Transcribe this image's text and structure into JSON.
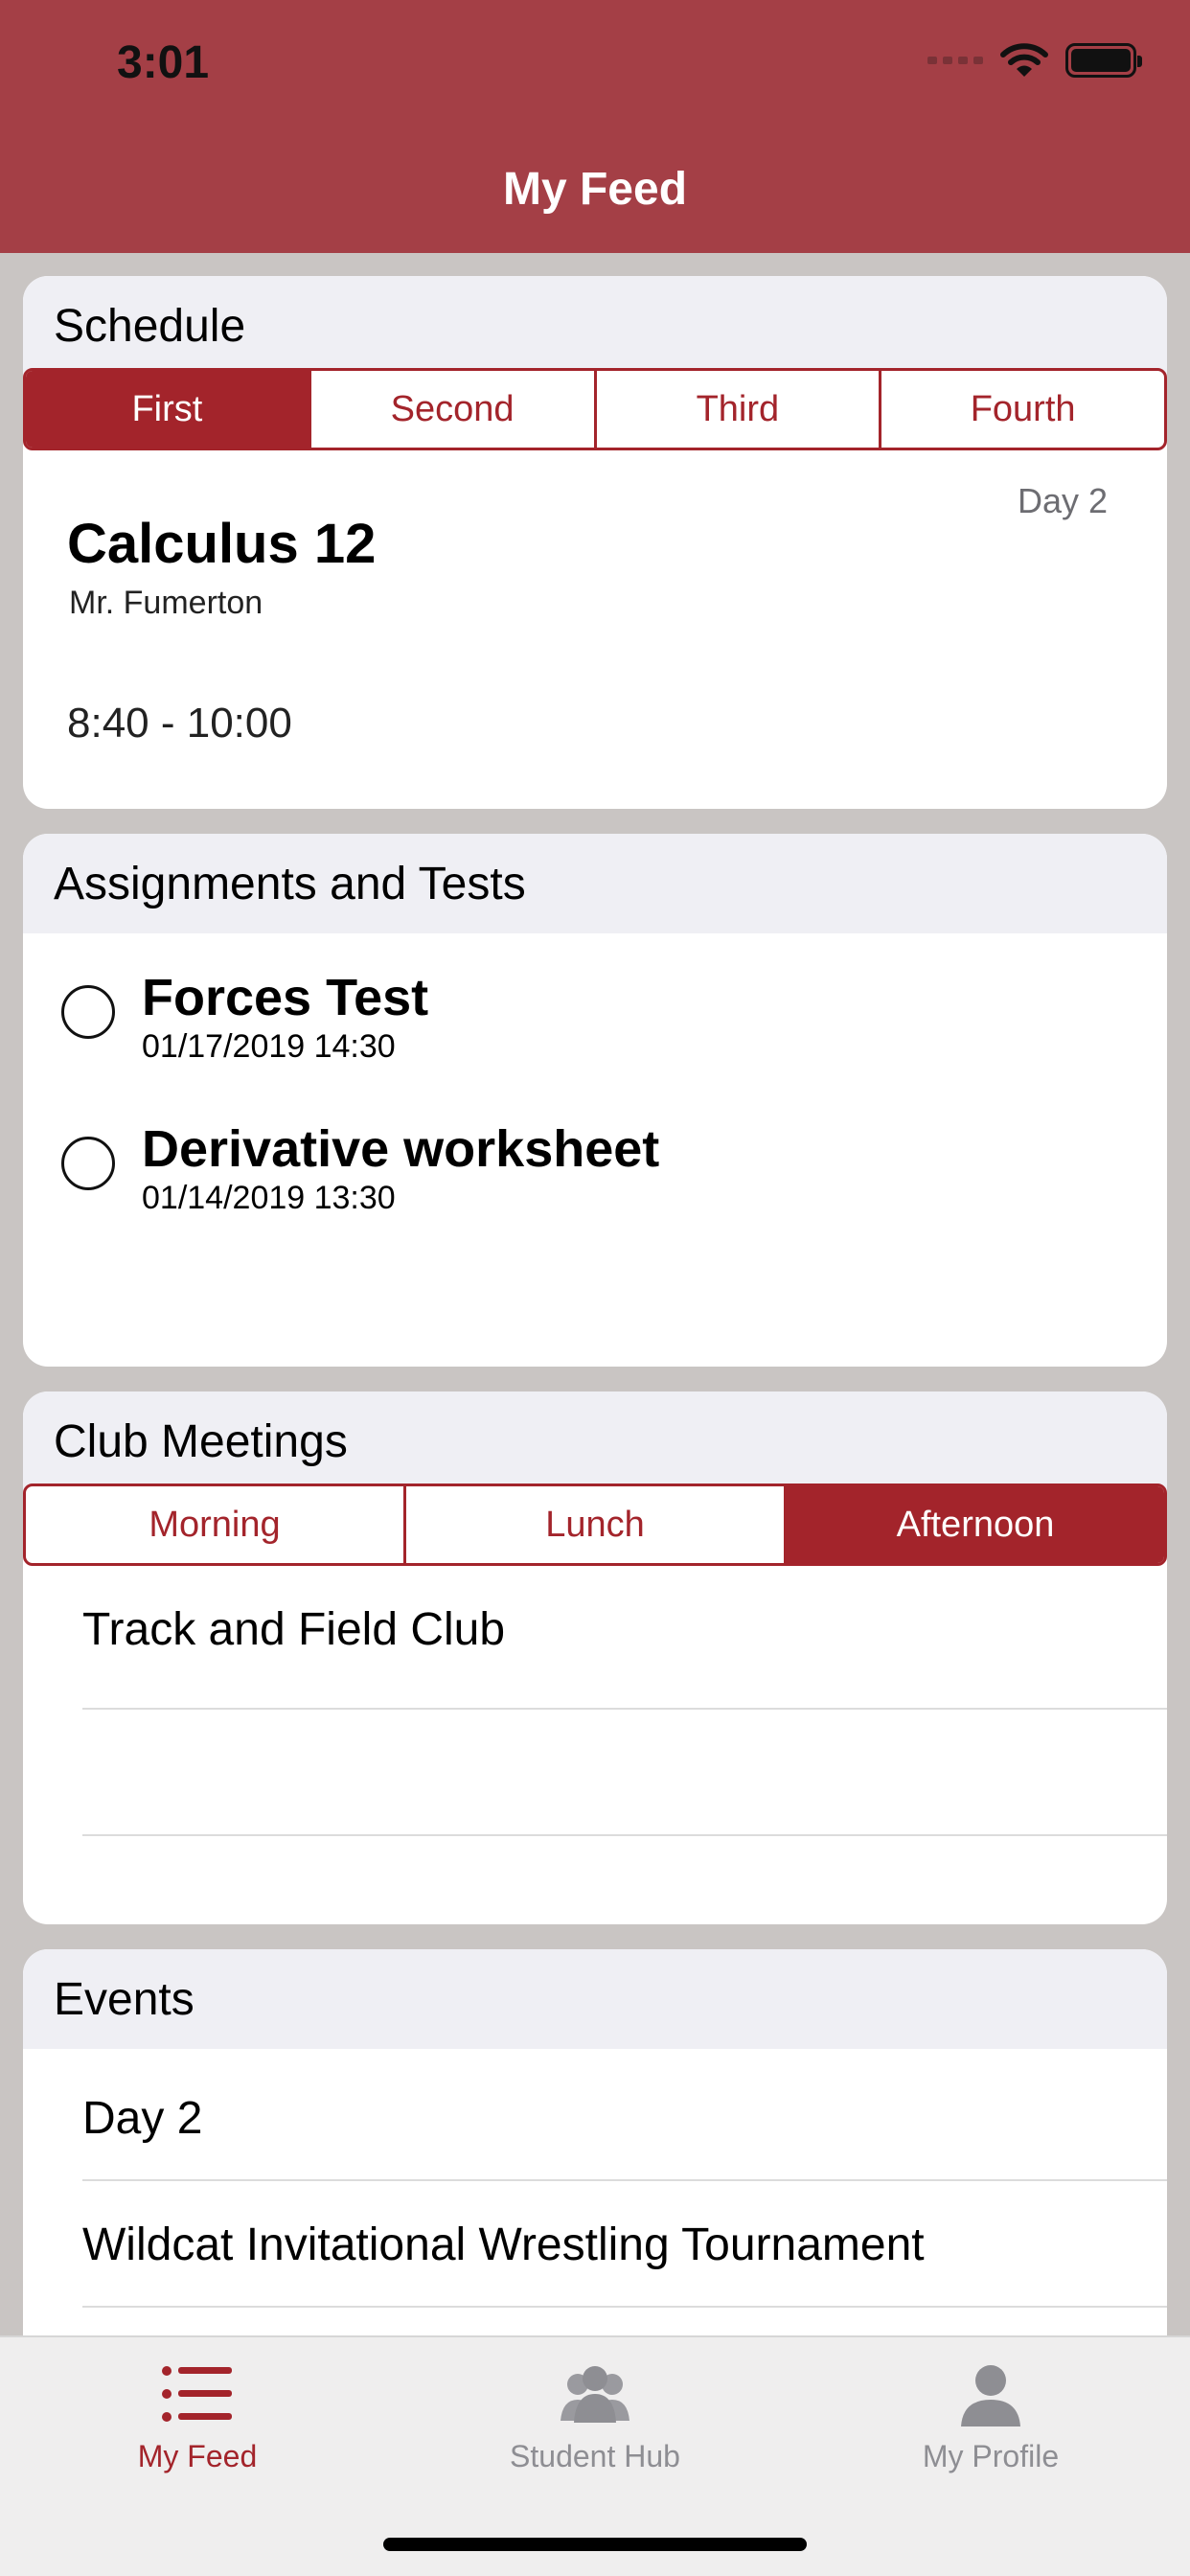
{
  "status": {
    "time": "3:01"
  },
  "nav": {
    "title": "My Feed"
  },
  "schedule": {
    "heading": "Schedule",
    "tabs": [
      "First",
      "Second",
      "Third",
      "Fourth"
    ],
    "active_tab": "First",
    "day": "Day 2",
    "course": "Calculus 12",
    "teacher": "Mr. Fumerton",
    "time": "8:40 - 10:00"
  },
  "assignments": {
    "heading": "Assignments and Tests",
    "items": [
      {
        "title": "Forces Test",
        "date": "01/17/2019 14:30"
      },
      {
        "title": "Derivative worksheet",
        "date": "01/14/2019 13:30"
      }
    ]
  },
  "clubs": {
    "heading": "Club Meetings",
    "tabs": [
      "Morning",
      "Lunch",
      "Afternoon"
    ],
    "active_tab": "Afternoon",
    "items": [
      "Track and Field Club"
    ]
  },
  "events": {
    "heading": "Events",
    "items": [
      "Day 2",
      "Wildcat Invitational Wrestling Tournament"
    ]
  },
  "tabbar": {
    "items": [
      {
        "label": "My Feed",
        "icon": "list-icon",
        "active": true
      },
      {
        "label": "Student Hub",
        "icon": "group-icon",
        "active": false
      },
      {
        "label": "My Profile",
        "icon": "person-icon",
        "active": false
      }
    ]
  },
  "colors": {
    "brand": "#a43f46",
    "accent": "#a3242b",
    "inactive_tab": "#8e8e93"
  }
}
